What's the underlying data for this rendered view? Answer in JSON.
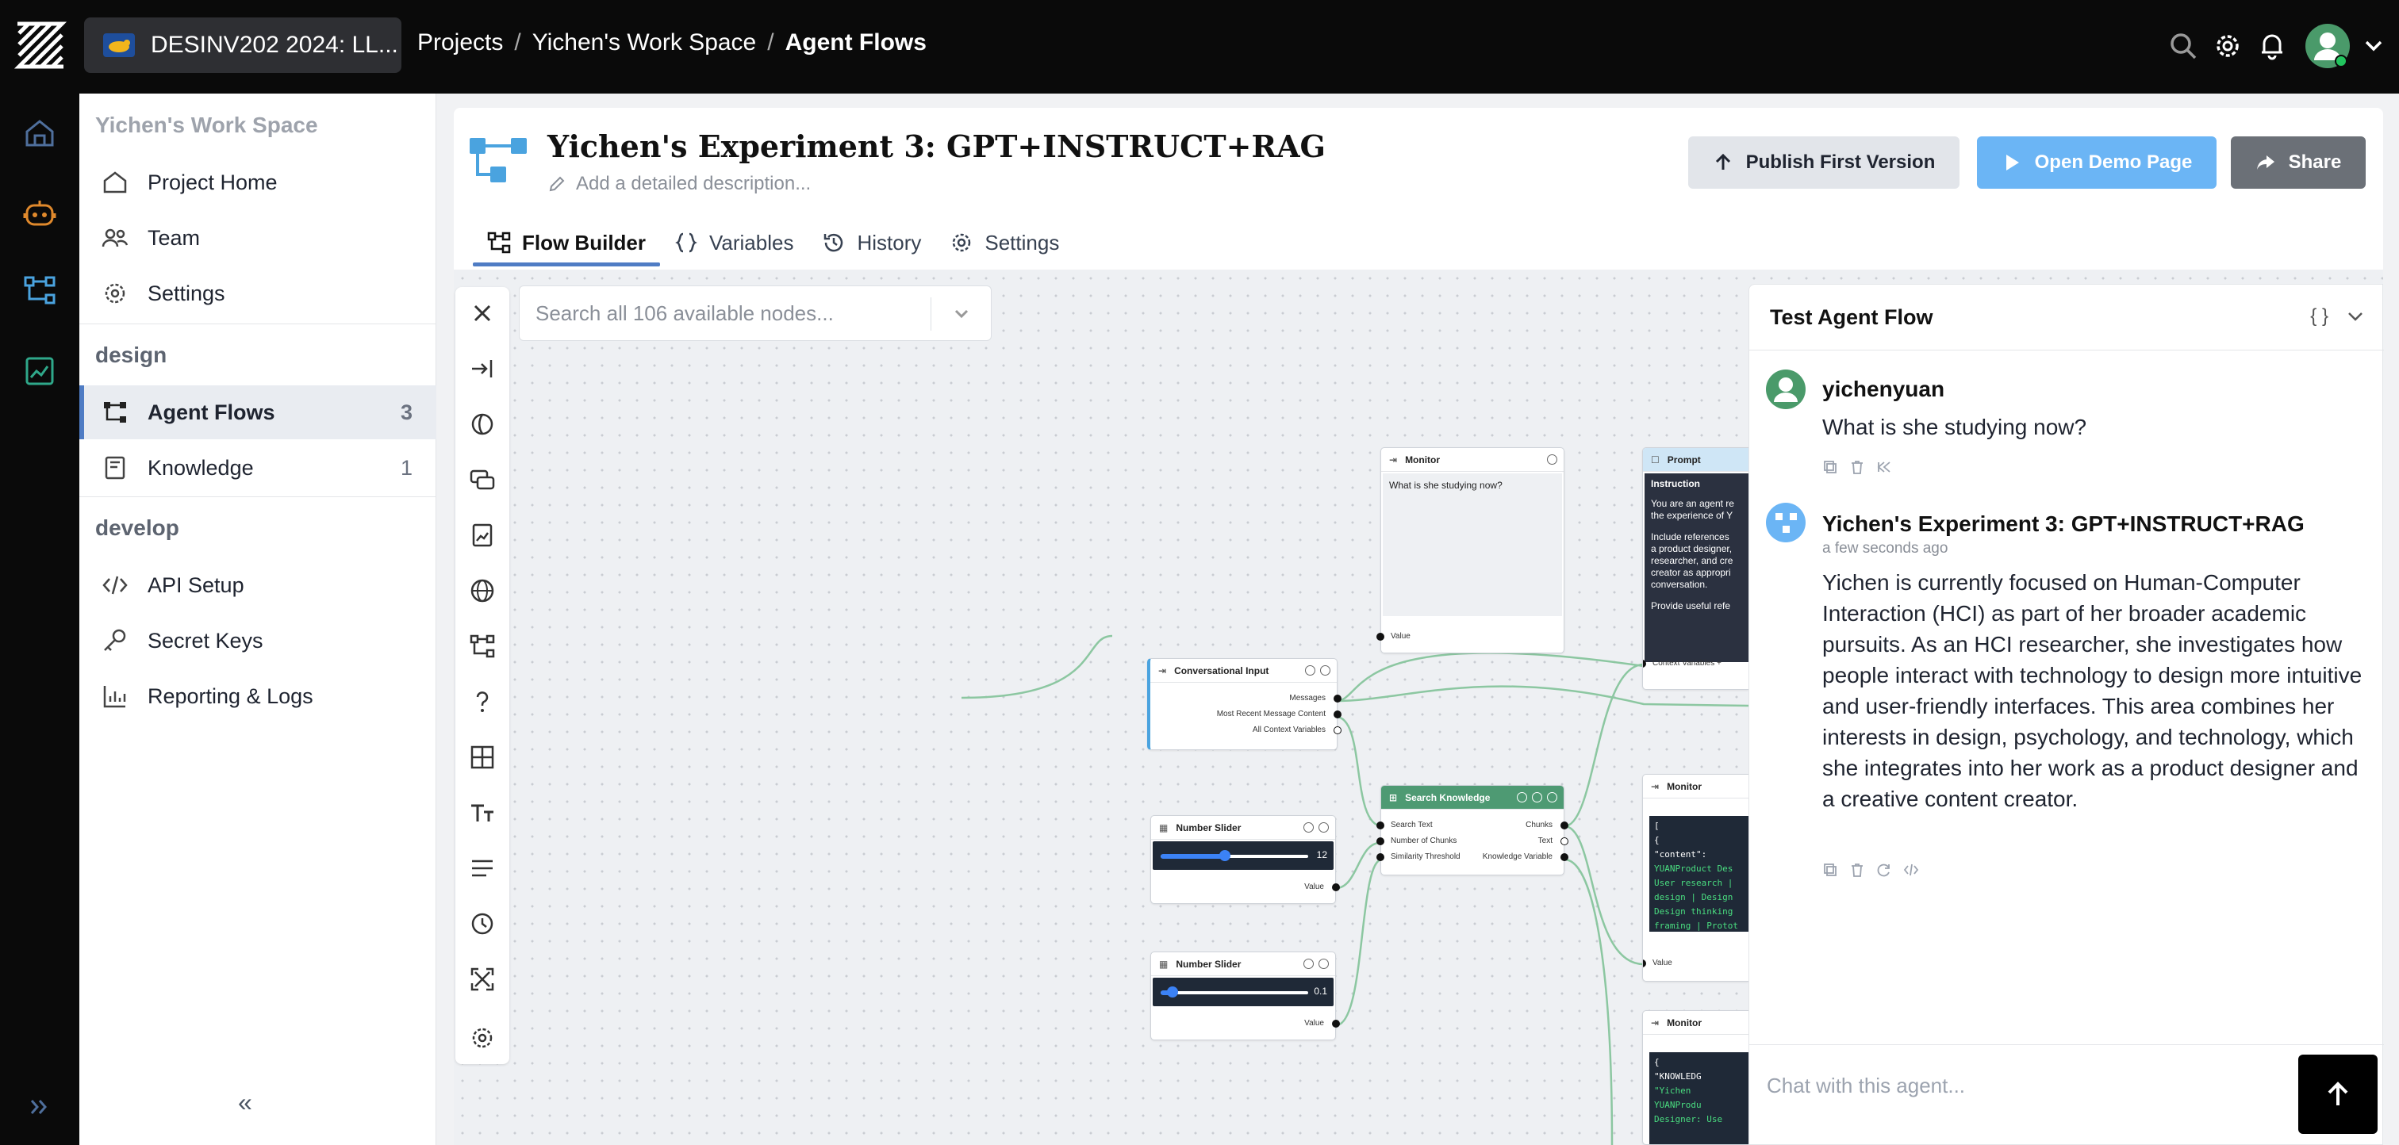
{
  "topbar": {
    "project_name": "DESINV202 2024: LL...",
    "breadcrumbs": [
      "Projects",
      "Yichen's Work Space",
      "Agent Flows"
    ],
    "icons": [
      "search-icon",
      "gear-icon",
      "bell-icon",
      "user-avatar-icon",
      "chevron-down-icon"
    ]
  },
  "rail": {
    "icons": [
      "home-icon",
      "robot-icon",
      "flow-icon",
      "knowledge-icon",
      "expand-icon"
    ]
  },
  "sidebar": {
    "workspace_title": "Yichen's Work Space",
    "workspace_items": [
      {
        "label": "Project Home",
        "icon": "home-icon"
      },
      {
        "label": "Team",
        "icon": "team-icon"
      },
      {
        "label": "Settings",
        "icon": "gear-icon"
      }
    ],
    "design_title": "design",
    "design_items": [
      {
        "label": "Agent Flows",
        "count": "3",
        "icon": "flow-icon"
      },
      {
        "label": "Knowledge",
        "count": "1",
        "icon": "book-icon"
      }
    ],
    "develop_title": "develop",
    "develop_items": [
      {
        "label": "API Setup",
        "icon": "code-icon"
      },
      {
        "label": "Secret Keys",
        "icon": "key-icon"
      },
      {
        "label": "Reporting & Logs",
        "icon": "chart-icon"
      }
    ],
    "collapse": "«"
  },
  "header": {
    "title": "Yichen's Experiment 3: GPT+INSTRUCT+RAG",
    "description_placeholder": "Add a detailed description...",
    "publish_label": "Publish First Version",
    "demo_label": "Open Demo Page",
    "share_label": "Share"
  },
  "tabs": [
    "Flow Builder",
    "Variables",
    "History",
    "Settings"
  ],
  "canvas": {
    "search_placeholder": "Search all 106 available nodes...",
    "nodes": {
      "monitor1": {
        "title": "Monitor",
        "content": "What is she studying now?",
        "port": "Value"
      },
      "prompt": {
        "title": "Prompt",
        "subtitle": "Instruction",
        "lines": [
          "You are an agent re",
          "the experience of Y",
          "",
          "Include references",
          "a product designer,",
          "researcher, and cre",
          "creator as appropri",
          "conversation.",
          "",
          "Provide useful refe"
        ],
        "port": "Context Variables +"
      },
      "conv_input": {
        "title": "Conversational Input",
        "ports": [
          "Messages",
          "Most Recent Message Content",
          "All Context Variables"
        ]
      },
      "search_knowledge": {
        "title": "Search Knowledge",
        "inputs": [
          "Search Text",
          "Number of Chunks",
          "Similarity Threshold"
        ],
        "outputs": [
          "Chunks",
          "Text",
          "Knowledge Variable"
        ]
      },
      "slider1": {
        "title": "Number Slider",
        "value": "12",
        "port": "Value"
      },
      "slider2": {
        "title": "Number Slider",
        "value": "0.1",
        "port": "Value"
      },
      "monitor2": {
        "title": "Monitor",
        "lines": [
          "[",
          "  {",
          "    \"content\":",
          "YUANProduct Des",
          "User research |",
          "design | Design",
          "Design thinking",
          "framing | Protot"
        ],
        "port": "Value"
      },
      "monitor3": {
        "title": "Monitor",
        "lines": [
          "{",
          "  \"KNOWLEDG",
          "    \"Yichen",
          "    YUANProdu",
          "    Designer: Use"
        ]
      }
    }
  },
  "chat": {
    "title": "Test Agent Flow",
    "user_name": "yichenyuan",
    "user_message": "What is she studying now?",
    "agent_name": "Yichen's Experiment 3: GPT+INSTRUCT+RAG",
    "agent_time": "a few seconds ago",
    "agent_message": "Yichen is currently focused on Human-Computer Interaction (HCI) as part of her broader academic pursuits. As an HCI researcher, she investigates how people interact with technology to design more intuitive and user-friendly interfaces. This area combines her interests in design, psychology, and technology, which she integrates into her work as a product designer and a creative content creator.",
    "input_placeholder": "Chat with this agent...",
    "header_icons": [
      "braces-icon",
      "chevron-down-icon"
    ]
  },
  "colors": {
    "accent": "#4f7cc4",
    "demo_button": "#6bb5f5",
    "share_button": "#6b7077",
    "search_knowledge": "#4e9a73",
    "topbar": "#0a0a0a"
  }
}
